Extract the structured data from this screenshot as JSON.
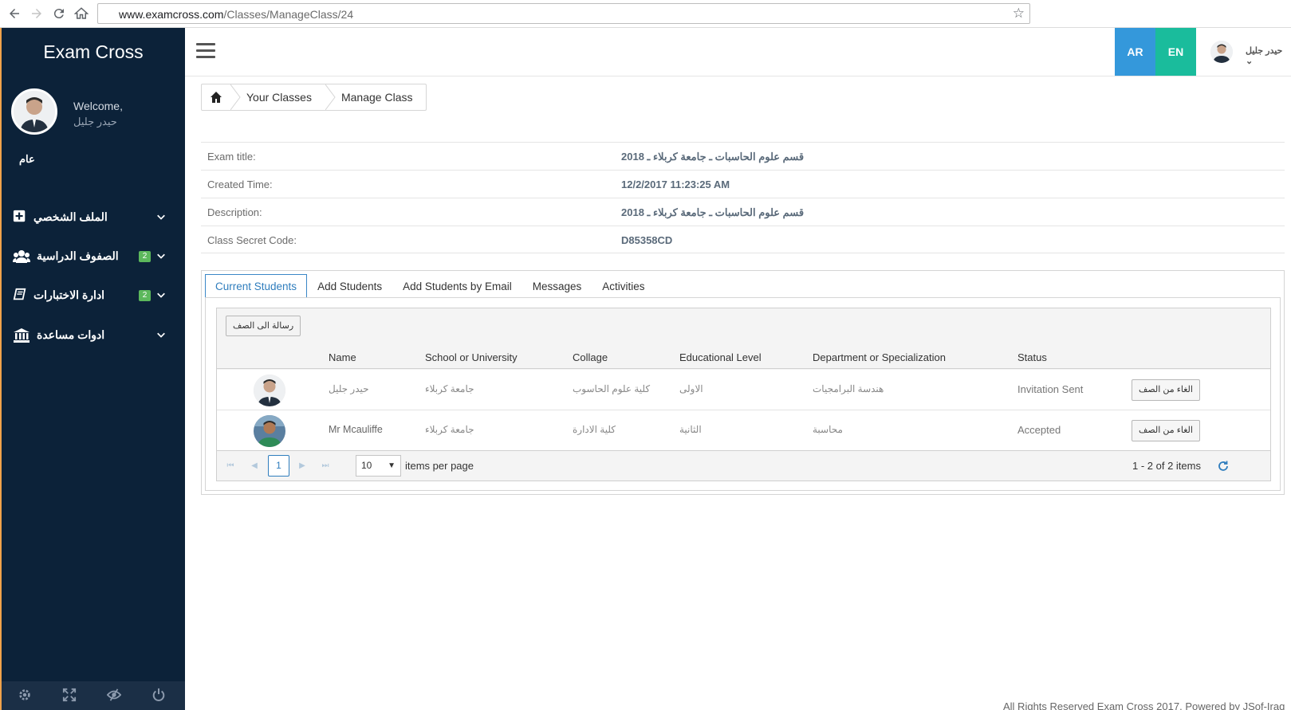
{
  "browser": {
    "url_host": "www.examcross.com",
    "url_path": "/Classes/ManageClass/24"
  },
  "colors": {
    "sidebar_bg": "#0c2239",
    "lang_ar_bg": "#3498db",
    "lang_en_bg": "#1abc9c",
    "badge_green": "#5cb85c",
    "accent_blue": "#2f7dbd"
  },
  "sidebar": {
    "brand": "Exam Cross",
    "welcome": "Welcome,",
    "user_name": "حيدر جليل",
    "section_label": "عام",
    "items": [
      {
        "label": "الملف الشخصي",
        "icon": "plus-square-icon",
        "badge": ""
      },
      {
        "label": "الصفوف الدراسية",
        "icon": "users-icon",
        "badge": "2"
      },
      {
        "label": "ادارة الاختبارات",
        "icon": "book-icon",
        "badge": "2"
      },
      {
        "label": "ادوات مساعدة",
        "icon": "institution-icon",
        "badge": ""
      }
    ],
    "footer_icons": [
      "settings-icon",
      "fullscreen-icon",
      "hide-eye-icon",
      "power-icon"
    ]
  },
  "topbar": {
    "lang_ar": "AR",
    "lang_en": "EN",
    "user_name": "حيدر جليل"
  },
  "breadcrumb": {
    "items": [
      "Your Classes",
      "Manage Class"
    ]
  },
  "info": {
    "rows": [
      {
        "label": "Exam title:",
        "value": "قسم علوم الحاسبات ـ جامعة كربلاء ـ 2018"
      },
      {
        "label": "Created Time:",
        "value": "12/2/2017 11:23:25 AM"
      },
      {
        "label": "Description:",
        "value": "قسم علوم الحاسبات ـ جامعة كربلاء ـ 2018"
      },
      {
        "label": "Class Secret Code:",
        "value": "D85358CD"
      }
    ]
  },
  "tabs": [
    "Current Students",
    "Add Students",
    "Add Students by Email",
    "Messages",
    "Activities"
  ],
  "grid": {
    "toolbar_button": "رسالة الى الصف",
    "columns": [
      "Name",
      "School or University",
      "Collage",
      "Educational Level",
      "Department or Specialization",
      "Status"
    ],
    "rows": [
      {
        "name": "حيدر جليل",
        "school": "جامعة كربلاء",
        "college": "كلية علوم الحاسوب",
        "level": "الاولى",
        "dept": "هندسة البرامجيات",
        "status": "Invitation Sent",
        "action": "الغاء من الصف"
      },
      {
        "name": "Mr Mcauliffe",
        "school": "جامعة كربلاء",
        "college": "كلية الادارة",
        "level": "الثانية",
        "dept": "محاسبة",
        "status": "Accepted",
        "action": "الغاء من الصف"
      }
    ],
    "pager": {
      "current_page": "1",
      "page_size": "10",
      "items_per_page": "items per page",
      "info": "1 - 2 of 2 items"
    }
  },
  "footer": {
    "text": "All Rights Reserved Exam Cross 2017. Powered by JSof-Iraq"
  }
}
